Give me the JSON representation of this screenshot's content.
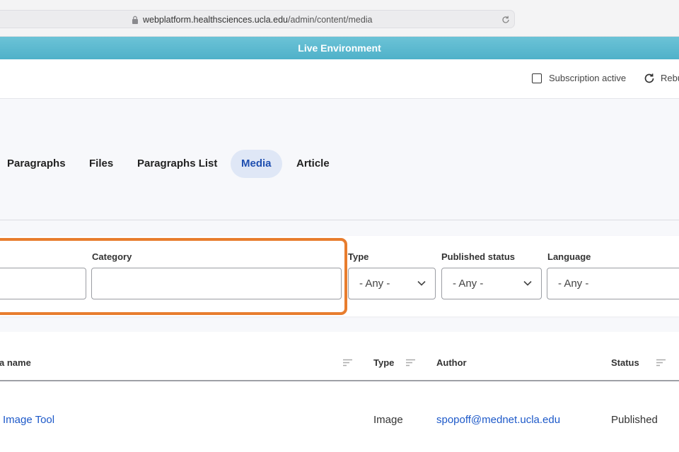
{
  "browser": {
    "url_host": "webplatform.healthsciences.ucla.edu",
    "url_path": "/admin/content/media"
  },
  "banner": {
    "text": "Live Environment",
    "color": "#5bb9cf"
  },
  "toolbar": {
    "subscription_label": "Subscription active",
    "rebuild_label": "Rebu"
  },
  "tabs": [
    {
      "label": "Paragraphs",
      "active": false
    },
    {
      "label": "Files",
      "active": false
    },
    {
      "label": "Paragraphs List",
      "active": false
    },
    {
      "label": "Media",
      "active": true
    },
    {
      "label": "Article",
      "active": false
    }
  ],
  "filters": {
    "category_label": "Category",
    "category_value": "",
    "type_label": "Type",
    "type_value": "- Any -",
    "published_label": "Published status",
    "published_value": "- Any -",
    "language_label": "Language",
    "language_value": "- Any -",
    "highlight_color": "#e87d2e"
  },
  "table": {
    "headers": [
      "a name",
      "Type",
      "Author",
      "Status"
    ],
    "rows": [
      {
        "name": "Image Tool",
        "type": "Image",
        "author": "spopoff@mednet.ucla.edu",
        "status": "Published"
      }
    ]
  },
  "icons": [
    "lock-icon",
    "reload-icon",
    "checkbox-icon",
    "rebuild-icon",
    "chevron-down-icon",
    "sort-icon"
  ]
}
